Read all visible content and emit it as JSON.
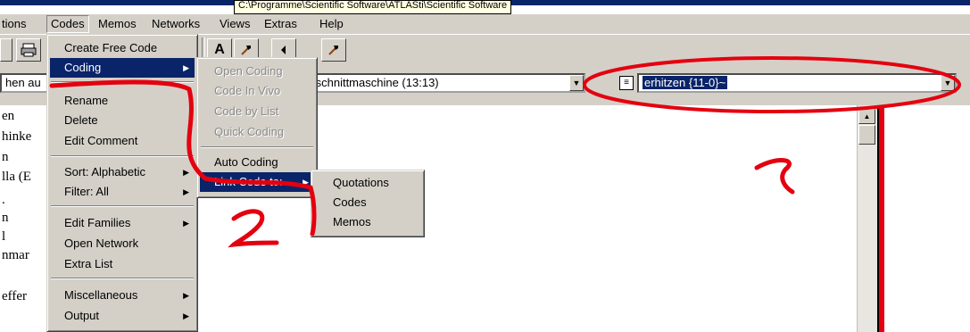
{
  "window": {
    "path_tooltip": "C:\\Programme\\Scientific Software\\ATLASti\\Scientific Software"
  },
  "menubar": {
    "items": [
      "tions",
      "Codes",
      "Memos",
      "Networks",
      "Views",
      "Extras",
      "Help"
    ]
  },
  "toolbar": {
    "icons": [
      "save-icon",
      "print-icon",
      "text-a-icon",
      "hammer-icon",
      "arrow-left-icon",
      "link-icon"
    ]
  },
  "combos": {
    "left_text": "hen au",
    "doc_text": "fschnittmaschine (13:13)",
    "code_text": "erhitzen {11-0}~"
  },
  "left_list": [
    "en",
    "hinke",
    "n",
    "lla (E",
    ".",
    "n",
    "l",
    "nmar",
    "",
    "effer"
  ],
  "codes_menu": {
    "items": [
      {
        "label": "Create Free Code",
        "submenu": false
      },
      {
        "label": "Coding",
        "submenu": true,
        "selected": true
      },
      {
        "label": "Rename",
        "submenu": false
      },
      {
        "label": "Delete",
        "submenu": false
      },
      {
        "label": "Edit Comment",
        "submenu": false
      },
      {
        "label": "Sort: Alphabetic",
        "submenu": true
      },
      {
        "label": "Filter: All",
        "submenu": true
      },
      {
        "label": "Edit Families",
        "submenu": true
      },
      {
        "label": "Open Network",
        "submenu": false
      },
      {
        "label": "Extra List",
        "submenu": false
      },
      {
        "label": "Miscellaneous",
        "submenu": true
      },
      {
        "label": "Output",
        "submenu": true
      }
    ]
  },
  "coding_menu": {
    "items": [
      {
        "label": "Open Coding",
        "disabled": true
      },
      {
        "label": "Code In Vivo",
        "disabled": true
      },
      {
        "label": "Code by List",
        "disabled": true
      },
      {
        "label": "Quick Coding",
        "disabled": true
      },
      {
        "label": "Auto Coding",
        "disabled": false
      },
      {
        "label": "Link Code to:",
        "disabled": false,
        "submenu": true,
        "selected": true
      }
    ]
  },
  "link_menu": {
    "items": [
      "Quotations",
      "Codes",
      "Memos"
    ]
  },
  "annotations": {
    "mark_1": "1",
    "mark_2": "2",
    "color": "#e4000f"
  }
}
